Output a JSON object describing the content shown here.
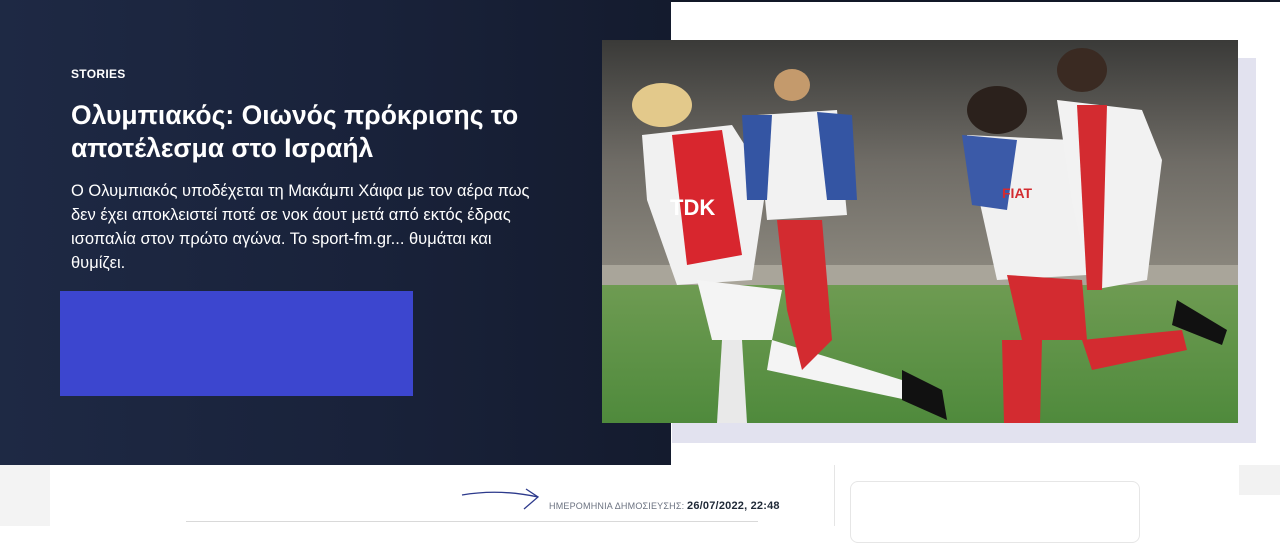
{
  "article": {
    "section_label": "STORIES",
    "headline": "Ολυμπιακός: Οιωνός πρόκρισης το αποτέλεσμα στο Ισραήλ",
    "lede": "Ο Ολυμπιακός υποδέχεται τη Μακάμπι Χάιφα με τον αέρα πως δεν έχει αποκλειστεί ποτέ σε νοκ άουτ μετά από εκτός έδρας ισοπαλία στον πρώτο αγώνα. Το sport-fm.gr... θυμάται και θυμίζει."
  },
  "meta": {
    "published_label": "ΗΜΕΡΟΜΗΝΙΑ ΔΗΜΟΣΙΕΥΣΗΣ:",
    "published_value": "26/07/2022, 22:48"
  },
  "photo": {
    "jersey_text_1": "TDK",
    "jersey_text_2": "FIAT"
  },
  "colors": {
    "hero_bg": "#1b2540",
    "cta_block": "#3c46cf",
    "pitch": "#5a8a45"
  }
}
